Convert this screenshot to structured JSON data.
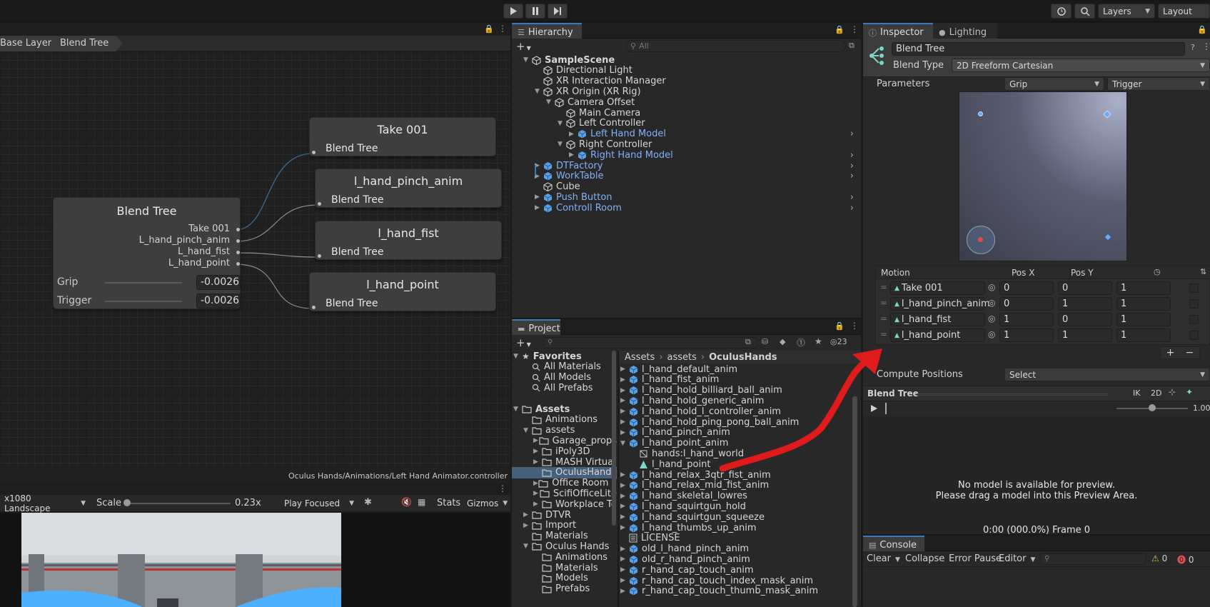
{
  "toolbar": {
    "layers": "Layers",
    "layout": "Layout"
  },
  "animator": {
    "breadcrumb": [
      "Base Layer",
      "Blend Tree"
    ],
    "path": "Oculus Hands/Animations/Left Hand Animator.controller",
    "blend_node": {
      "title": "Blend Tree",
      "motions": [
        "Take 001",
        "L_hand_pinch_anim",
        "L_hand_fist",
        "L_hand_point"
      ],
      "params": [
        {
          "label": "Grip",
          "value": "-0.0026"
        },
        {
          "label": "Trigger",
          "value": "-0.0026"
        }
      ]
    },
    "motion_nodes": [
      {
        "title": "Take 001",
        "sub": "Blend Tree"
      },
      {
        "title": "l_hand_pinch_anim",
        "sub": "Blend Tree"
      },
      {
        "title": "l_hand_fist",
        "sub": "Blend Tree"
      },
      {
        "title": "l_hand_point",
        "sub": "Blend Tree"
      }
    ]
  },
  "game": {
    "resolution": "x1080 Landscape",
    "scale_label": "Scale",
    "scale_value": "0.23x",
    "play_mode": "Play Focused",
    "stats": "Stats",
    "gizmos": "Gizmos"
  },
  "hierarchy": {
    "tab": "Hierarchy",
    "search_placeholder": "All",
    "items": [
      {
        "label": "SampleScene",
        "indent": 0,
        "arrow": "▼",
        "bold": true,
        "blue": false,
        "icon": "unity-scene-icon"
      },
      {
        "label": "Directional Light",
        "indent": 1,
        "arrow": "",
        "blue": false,
        "icon": "gameobject-icon"
      },
      {
        "label": "XR Interaction Manager",
        "indent": 1,
        "arrow": "",
        "blue": false,
        "icon": "gameobject-icon"
      },
      {
        "label": "XR Origin (XR Rig)",
        "indent": 1,
        "arrow": "▼",
        "blue": false,
        "icon": "gameobject-icon"
      },
      {
        "label": "Camera Offset",
        "indent": 2,
        "arrow": "▼",
        "blue": false,
        "icon": "gameobject-icon"
      },
      {
        "label": "Main Camera",
        "indent": 3,
        "arrow": "",
        "blue": false,
        "icon": "gameobject-icon"
      },
      {
        "label": "Left Controller",
        "indent": 3,
        "arrow": "▼",
        "blue": false,
        "icon": "gameobject-icon"
      },
      {
        "label": "Left Hand Model",
        "indent": 4,
        "arrow": "▶",
        "blue": true,
        "icon": "prefab-icon",
        "more": true
      },
      {
        "label": "Right Controller",
        "indent": 3,
        "arrow": "▼",
        "blue": false,
        "icon": "gameobject-icon"
      },
      {
        "label": "Right Hand Model",
        "indent": 4,
        "arrow": "▶",
        "blue": true,
        "icon": "prefab-icon",
        "more": true
      },
      {
        "label": "DTFactory",
        "indent": 1,
        "arrow": "▶",
        "blue": true,
        "icon": "prefab-icon",
        "more": true
      },
      {
        "label": "WorkTable",
        "indent": 1,
        "arrow": "▶",
        "blue": true,
        "icon": "prefab-icon",
        "more": true
      },
      {
        "label": "Cube",
        "indent": 1,
        "arrow": "",
        "blue": false,
        "icon": "gameobject-icon"
      },
      {
        "label": "Push Button",
        "indent": 1,
        "arrow": "▶",
        "blue": true,
        "icon": "prefab-icon",
        "more": true
      },
      {
        "label": "Controll Room",
        "indent": 1,
        "arrow": "▶",
        "blue": true,
        "icon": "prefab-icon",
        "more": true
      }
    ]
  },
  "project": {
    "tab": "Project",
    "count": "23",
    "breadcrumb": [
      "Assets",
      "assets",
      "OculusHands"
    ],
    "tree": [
      {
        "label": "Favorites",
        "indent": 0,
        "arrow": "▼",
        "bold": true,
        "icon": "star-icon"
      },
      {
        "label": "All Materials",
        "indent": 1,
        "arrow": "",
        "icon": "search-icon"
      },
      {
        "label": "All Models",
        "indent": 1,
        "arrow": "",
        "icon": "search-icon"
      },
      {
        "label": "All Prefabs",
        "indent": 1,
        "arrow": "",
        "icon": "search-icon"
      },
      {
        "label": "",
        "indent": 0,
        "arrow": "",
        "icon": ""
      },
      {
        "label": "Assets",
        "indent": 0,
        "arrow": "▼",
        "bold": true,
        "icon": "folder-icon"
      },
      {
        "label": "Animations",
        "indent": 1,
        "arrow": "",
        "icon": "folder-icon"
      },
      {
        "label": "assets",
        "indent": 1,
        "arrow": "▼",
        "icon": "folder-icon"
      },
      {
        "label": "Garage_props",
        "indent": 2,
        "arrow": "▶",
        "icon": "folder-icon"
      },
      {
        "label": "iPoly3D",
        "indent": 2,
        "arrow": "▶",
        "icon": "folder-icon"
      },
      {
        "label": "MASH Virtual",
        "indent": 2,
        "arrow": "▶",
        "icon": "folder-icon"
      },
      {
        "label": "OculusHands",
        "indent": 2,
        "arrow": "",
        "icon": "folder-icon",
        "selected": true
      },
      {
        "label": "Office Room F",
        "indent": 2,
        "arrow": "▶",
        "icon": "folder-icon"
      },
      {
        "label": "ScifiOfficeLite",
        "indent": 2,
        "arrow": "▶",
        "icon": "folder-icon"
      },
      {
        "label": "Workplace To",
        "indent": 2,
        "arrow": "▶",
        "icon": "folder-icon"
      },
      {
        "label": "DTVR",
        "indent": 1,
        "arrow": "▶",
        "icon": "folder-icon"
      },
      {
        "label": "Import",
        "indent": 1,
        "arrow": "▶",
        "icon": "folder-icon"
      },
      {
        "label": "Materials",
        "indent": 1,
        "arrow": "",
        "icon": "folder-icon"
      },
      {
        "label": "Oculus Hands",
        "indent": 1,
        "arrow": "▼",
        "icon": "folder-icon"
      },
      {
        "label": "Animations",
        "indent": 2,
        "arrow": "",
        "icon": "folder-icon"
      },
      {
        "label": "Materials",
        "indent": 2,
        "arrow": "",
        "icon": "folder-icon"
      },
      {
        "label": "Models",
        "indent": 2,
        "arrow": "",
        "icon": "folder-icon"
      },
      {
        "label": "Prefabs",
        "indent": 2,
        "arrow": "",
        "icon": "folder-icon"
      }
    ],
    "files": [
      {
        "label": "l_hand_default_anim",
        "indent": 0,
        "arrow": "▶",
        "icon": "model-icon"
      },
      {
        "label": "l_hand_fist_anim",
        "indent": 0,
        "arrow": "▶",
        "icon": "model-icon"
      },
      {
        "label": "l_hand_hold_billiard_ball_anim",
        "indent": 0,
        "arrow": "▶",
        "icon": "model-icon"
      },
      {
        "label": "l_hand_hold_generic_anim",
        "indent": 0,
        "arrow": "▶",
        "icon": "model-icon"
      },
      {
        "label": "l_hand_hold_l_controller_anim",
        "indent": 0,
        "arrow": "▶",
        "icon": "model-icon"
      },
      {
        "label": "l_hand_hold_ping_pong_ball_anim",
        "indent": 0,
        "arrow": "▶",
        "icon": "model-icon"
      },
      {
        "label": "l_hand_pinch_anim",
        "indent": 0,
        "arrow": "▶",
        "icon": "model-icon"
      },
      {
        "label": "l_hand_point_anim",
        "indent": 0,
        "arrow": "▼",
        "icon": "model-icon"
      },
      {
        "label": "hands:l_hand_world",
        "indent": 1,
        "arrow": "",
        "icon": "mesh-icon"
      },
      {
        "label": "l_hand_point",
        "indent": 1,
        "arrow": "",
        "icon": "anim-clip-icon"
      },
      {
        "label": "l_hand_relax_3qtr_fist_anim",
        "indent": 0,
        "arrow": "▶",
        "icon": "model-icon"
      },
      {
        "label": "l_hand_relax_mid_fist_anim",
        "indent": 0,
        "arrow": "▶",
        "icon": "model-icon"
      },
      {
        "label": "l_hand_skeletal_lowres",
        "indent": 0,
        "arrow": "▶",
        "icon": "model-icon"
      },
      {
        "label": "l_hand_squirtgun_hold",
        "indent": 0,
        "arrow": "▶",
        "icon": "model-icon"
      },
      {
        "label": "l_hand_squirtgun_squeeze",
        "indent": 0,
        "arrow": "▶",
        "icon": "model-icon"
      },
      {
        "label": "l_hand_thumbs_up_anim",
        "indent": 0,
        "arrow": "▶",
        "icon": "model-icon"
      },
      {
        "label": "LICENSE",
        "indent": 0,
        "arrow": "",
        "icon": "text-file-icon"
      },
      {
        "label": "old_l_hand_pinch_anim",
        "indent": 0,
        "arrow": "▶",
        "icon": "model-icon"
      },
      {
        "label": "old_r_hand_pinch_anim",
        "indent": 0,
        "arrow": "▶",
        "icon": "model-icon"
      },
      {
        "label": "r_hand_cap_touch_anim",
        "indent": 0,
        "arrow": "▶",
        "icon": "model-icon"
      },
      {
        "label": "r_hand_cap_touch_index_mask_anim",
        "indent": 0,
        "arrow": "▶",
        "icon": "model-icon"
      },
      {
        "label": "r_hand_cap_touch_thumb_mask_anim",
        "indent": 0,
        "arrow": "▶",
        "icon": "model-icon"
      }
    ]
  },
  "inspector": {
    "tab": "Inspector",
    "tab2": "Lighting",
    "name": "Blend Tree",
    "blend_type_label": "Blend Type",
    "blend_type": "2D Freeform Cartesian",
    "parameters_label": "Parameters",
    "param_x": "Grip",
    "param_y": "Trigger",
    "motion_header": "Motion",
    "posx_header": "Pos X",
    "posy_header": "Pos Y",
    "motions": [
      {
        "name": "Take 001",
        "x": "0",
        "y": "0",
        "speed": "1"
      },
      {
        "name": "l_hand_pinch_anim",
        "x": "0",
        "y": "1",
        "speed": "1"
      },
      {
        "name": "l_hand_fist",
        "x": "1",
        "y": "0",
        "speed": "1"
      },
      {
        "name": "l_hand_point",
        "x": "1",
        "y": "1",
        "speed": "1"
      }
    ],
    "compute_label": "Compute Positions",
    "compute_value": "Select",
    "preview_title": "Blend Tree",
    "ik": "IK",
    "twod": "2D",
    "speed_value": "1.00",
    "preview_msg1": "No model is available for preview.",
    "preview_msg2": "Please drag a model into this Preview Area.",
    "time": "0:00 (000.0%) Frame 0"
  },
  "console": {
    "tab": "Console",
    "clear": "Clear",
    "collapse": "Collapse",
    "error_pause": "Error Pause",
    "editor": "Editor",
    "warn_count": "0",
    "err_count": "0"
  },
  "colors": {
    "accent": "#3a79bb",
    "prefab": "#7fb2f5",
    "annotation": "#e01b1b"
  }
}
